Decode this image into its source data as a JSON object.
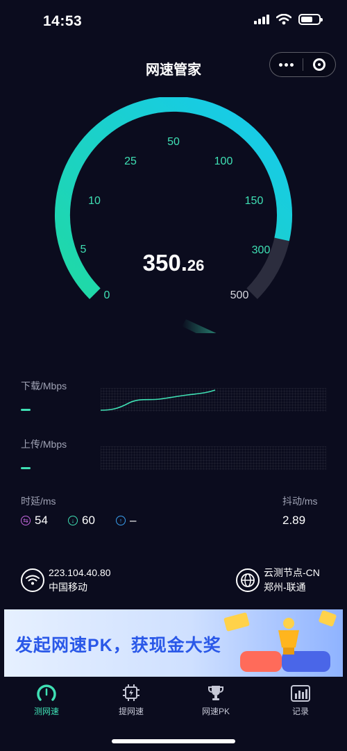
{
  "status_bar": {
    "time": "14:53"
  },
  "header": {
    "title": "网速管家"
  },
  "gauge": {
    "ticks": [
      "0",
      "5",
      "10",
      "25",
      "50",
      "100",
      "150",
      "300",
      "500"
    ],
    "speed_integer": "350.",
    "speed_decimal": "26",
    "progress_fraction": 0.88,
    "accent_start": "#20d9a4",
    "accent_end": "#16c9f0"
  },
  "download": {
    "label": "下载/Mbps",
    "value": "–"
  },
  "upload": {
    "label": "上传/Mbps",
    "value": "–"
  },
  "latency": {
    "label": "时延/ms",
    "idle": "54",
    "down": "60",
    "up": "–"
  },
  "jitter": {
    "label": "抖动/ms",
    "value": "2.89"
  },
  "network": {
    "ip": "223.104.40.80",
    "carrier": "中国移动",
    "node_name": "云测节点-CN",
    "node_location": "郑州-联通"
  },
  "banner": {
    "text": "发起网速PK，获现金大奖"
  },
  "tabs": [
    {
      "label": "测网速",
      "icon": "speedometer-icon",
      "active": true
    },
    {
      "label": "提网速",
      "icon": "chip-icon",
      "active": false
    },
    {
      "label": "网速PK",
      "icon": "trophy-icon",
      "active": false
    },
    {
      "label": "记录",
      "icon": "record-icon",
      "active": false
    }
  ]
}
